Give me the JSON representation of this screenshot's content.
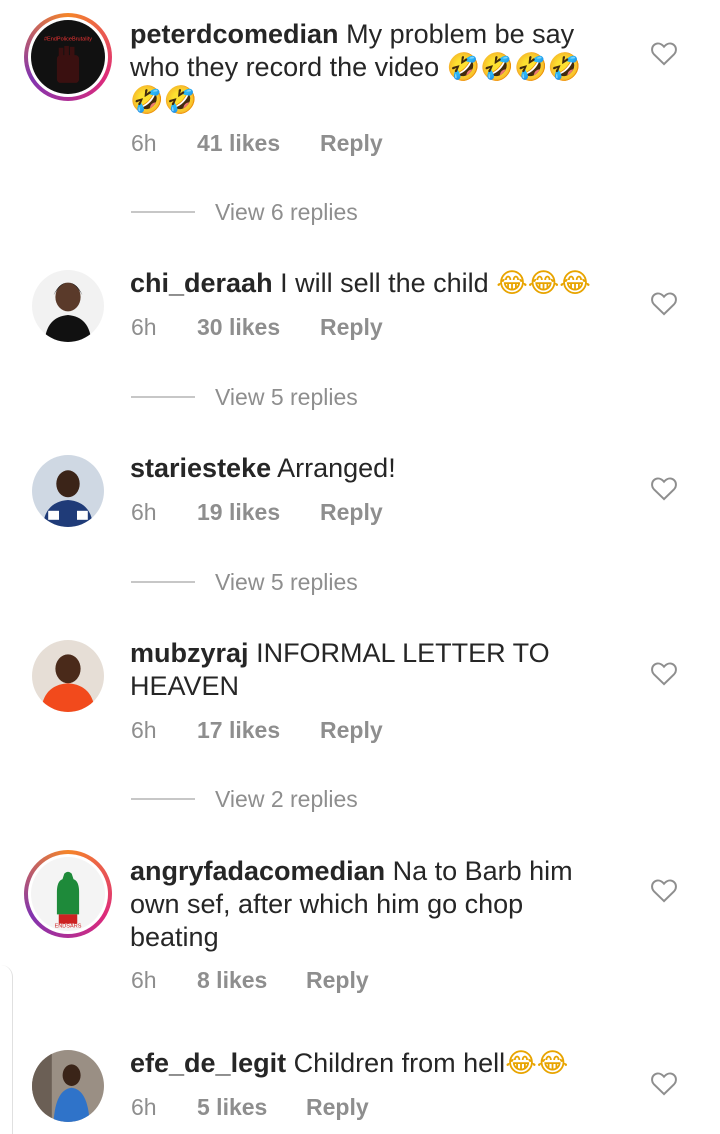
{
  "colors": {
    "text": "#262626",
    "meta": "#8e8e8e",
    "ring": "#dd2a7b"
  },
  "comments": [
    {
      "username": "peterdcomedian",
      "text": "My problem be say who they record the video",
      "emoji": "🤣🤣🤣🤣🤣🤣",
      "time": "6h",
      "likes": "41 likes",
      "reply": "Reply",
      "view_replies": "View 6 replies",
      "avatar_text": "#EndPoliceBrutality"
    },
    {
      "username": "chi_deraah",
      "text": "I will sell the child",
      "emoji": "😂😂😂",
      "time": "6h",
      "likes": "30 likes",
      "reply": "Reply",
      "view_replies": "View 5 replies"
    },
    {
      "username": "stariesteke",
      "text": "Arranged!",
      "emoji": "",
      "time": "6h",
      "likes": "19 likes",
      "reply": "Reply",
      "view_replies": "View 5 replies"
    },
    {
      "username": "mubzyraj",
      "text": "INFORMAL LETTER TO HEAVEN",
      "emoji": "",
      "time": "6h",
      "likes": "17 likes",
      "reply": "Reply",
      "view_replies": "View 2 replies"
    },
    {
      "username": "angryfadacomedian",
      "text": "Na to Barb him own sef, after which him go chop beating",
      "emoji": "",
      "time": "6h",
      "likes": "8 likes",
      "reply": "Reply",
      "avatar_text": "ENDSARS"
    },
    {
      "username": "efe_de_legit",
      "text": "Children from hell",
      "emoji": "😂😂",
      "time": "6h",
      "likes": "5 likes",
      "reply": "Reply"
    }
  ]
}
